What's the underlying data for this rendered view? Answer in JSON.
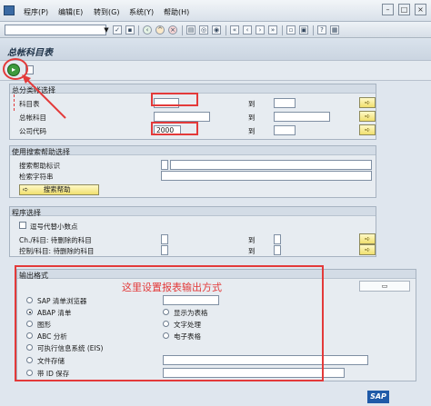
{
  "menu": {
    "items": [
      "程序(P)",
      "编辑(E)",
      "转到(G)",
      "系统(Y)",
      "帮助(H)"
    ]
  },
  "toolbar": {
    "command_value": "",
    "icons": [
      "enter-icon",
      "save-icon",
      "back-icon",
      "exit-icon",
      "cancel-icon",
      "print-icon",
      "find-icon",
      "find-next-icon",
      "first-page-icon",
      "prev-page-icon",
      "next-page-icon",
      "last-page-icon",
      "new-session-icon",
      "shortcut-icon",
      "help-icon",
      "layout-icon"
    ]
  },
  "page": {
    "title": "总帐科目表"
  },
  "ledger_selection": {
    "title": "总分类帐选择",
    "rows": [
      {
        "label": "科目表",
        "from": "",
        "to_label": "到",
        "to": ""
      },
      {
        "label": "总帐科目",
        "from": "",
        "to_label": "到",
        "to": ""
      },
      {
        "label": "公司代码",
        "from": "2000",
        "to_label": "到",
        "to": ""
      }
    ]
  },
  "search_help": {
    "title": "使用搜索帮助选择",
    "id_label": "搜索帮助标识",
    "string_label": "检索字符串",
    "button_label": "搜索帮助"
  },
  "program_selection": {
    "title": "程序选择",
    "checkbox_label": "逗号代替小数点",
    "row1_label": "Ch./科目: 待删除的科目",
    "row2_label": "控制/科目: 待删除的科目",
    "to_label": "到"
  },
  "output_format": {
    "title": "输出格式",
    "options_left": [
      "SAP 清单浏览器",
      "ABAP 清单",
      "图形",
      "ABC 分析",
      "可执行信息系统 (EIS)",
      "文件存储",
      "带 ID 保存"
    ],
    "options_right": [
      "显示为表格",
      "文字处理",
      "电子表格"
    ],
    "selected": "ABAP 清单"
  },
  "annotation": {
    "text": "这里设置报表输出方式"
  },
  "branding": {
    "logo": "SAP"
  },
  "colors": {
    "annotation_red": "#e33a3a",
    "execute_green": "#3d9a3d"
  }
}
